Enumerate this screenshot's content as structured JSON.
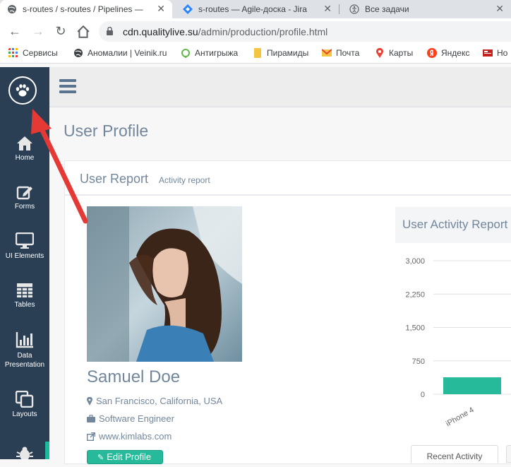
{
  "browser": {
    "tabs": [
      {
        "title": "s-routes / s-routes / Pipelines —"
      },
      {
        "title": "s-routes — Agile-доска - Jira"
      },
      {
        "title": "Все задачи"
      }
    ],
    "url_host": "cdn.qualitylive.su",
    "url_path": "/admin/production/profile.html",
    "bookmarks": [
      {
        "label": "Сервисы",
        "color": "#4285f4"
      },
      {
        "label": "Аномалии | Veinik.ru",
        "color": "#3c4043"
      },
      {
        "label": "Антигрыжа",
        "color": "#5fb847"
      },
      {
        "label": "Пирамиды",
        "color": "#f4c542"
      },
      {
        "label": "Почта",
        "color": "#ea4335"
      },
      {
        "label": "Карты",
        "color": "#ea4335"
      },
      {
        "label": "Яндекс",
        "color": "#fc3f1d"
      },
      {
        "label": "Но",
        "color": "#c5221f"
      }
    ]
  },
  "sidebar": {
    "items": [
      {
        "label": "Home",
        "icon": "home-icon"
      },
      {
        "label": "Forms",
        "icon": "edit-icon"
      },
      {
        "label": "UI Elements",
        "icon": "desktop-icon"
      },
      {
        "label": "Tables",
        "icon": "table-icon"
      },
      {
        "label": "Data Presentation",
        "icon": "bar-chart-icon"
      },
      {
        "label": "Layouts",
        "icon": "clone-icon"
      }
    ]
  },
  "page": {
    "title": "User Profile",
    "panel_title": "User Report",
    "panel_subtitle": "Activity report"
  },
  "profile": {
    "name": "Samuel Doe",
    "location": "San Francisco, California, USA",
    "job": "Software Engineer",
    "website": "www.kimlabs.com",
    "edit_label": "Edit Profile"
  },
  "chart_data": {
    "type": "bar",
    "title": "User Activity Report",
    "yticks": [
      "3,000",
      "2,250",
      "1,500",
      "750",
      "0"
    ],
    "ylim": [
      0,
      3000
    ],
    "categories": [
      "iPhone 4"
    ],
    "values": [
      380
    ],
    "bar_color": "#26b99a"
  },
  "tabs": {
    "recent_activity": "Recent Activity"
  },
  "colors": {
    "sidebar": "#2a3f54",
    "accent": "#1abb9c",
    "arrow": "#e53935"
  }
}
